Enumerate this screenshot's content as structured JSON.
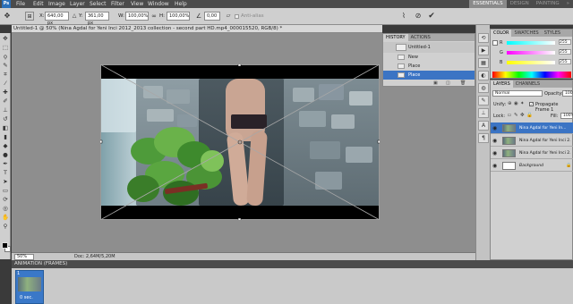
{
  "menu": {
    "logo": "Ps",
    "items": [
      "File",
      "Edit",
      "Image",
      "Layer",
      "Select",
      "Filter",
      "View",
      "Window",
      "Help"
    ],
    "workspaces": [
      "ESSENTIALS",
      "DESIGN",
      "PAINTING",
      "»"
    ]
  },
  "options": {
    "x_label": "X:",
    "x_value": "640,00 px",
    "y_label": "Y:",
    "y_value": "361,00 px",
    "w_label": "W:",
    "w_value": "100,00%",
    "h_label": "H:",
    "h_value": "100,00%",
    "angle_value": "0,00",
    "antialias_label": "Anti-alias"
  },
  "document": {
    "tab_title": "Untitled-1 @ 50% (Nina Agdal for Yeni Inci 2012_2013 collection - second part HD.mp4_000015520, RGB/8) *",
    "zoom": "50%",
    "doc_info": "Doc: 2,64M/5,20M"
  },
  "history": {
    "tabs": [
      "HISTORY",
      "ACTIONS"
    ],
    "snapshot": "Untitled-1",
    "states": [
      "New",
      "Place",
      "Place"
    ]
  },
  "color_panel": {
    "tabs": [
      "COLOR",
      "SWATCHES",
      "STYLES"
    ],
    "channels": [
      {
        "label": "R",
        "value": "255"
      },
      {
        "label": "G",
        "value": "255"
      },
      {
        "label": "B",
        "value": "255"
      }
    ]
  },
  "layers_panel": {
    "tabs": [
      "LAYERS",
      "CHANNELS"
    ],
    "blend_mode": "Normal",
    "opacity_label": "Opacity:",
    "opacity_value": "100%",
    "unify_label": "Unify:",
    "propagate_label": "Propagate Frame 1",
    "lock_label": "Lock:",
    "fill_label": "Fill:",
    "fill_value": "100%",
    "layers": [
      {
        "name": "Nina Agdal for Yeni In...",
        "selected": true
      },
      {
        "name": "Nina Agdal for Yeni Inci 2...",
        "selected": false
      },
      {
        "name": "Nina Agdal for Yeni Inci 2...",
        "selected": false
      },
      {
        "name": "Background",
        "selected": false
      }
    ]
  },
  "animation": {
    "title": "ANIMATION (FRAMES)",
    "frame_number": "1",
    "frame_duration": "0 sec."
  }
}
